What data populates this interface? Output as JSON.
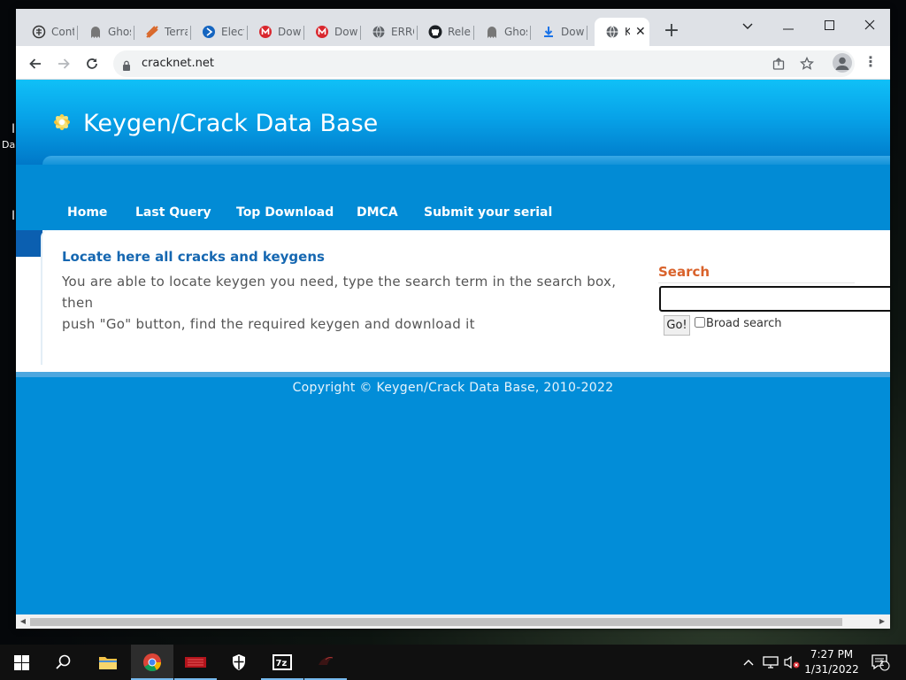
{
  "desktop": {
    "icon_labels": [
      "I",
      "Da",
      "I"
    ]
  },
  "browser": {
    "tabs": [
      {
        "label": "Cont",
        "icon": "cont-icon"
      },
      {
        "label": "Ghos",
        "icon": "ghost-icon"
      },
      {
        "label": "Terra",
        "icon": "terraria-icon"
      },
      {
        "label": "Elect",
        "icon": "electron-icon"
      },
      {
        "label": "Dow",
        "icon": "mega-icon"
      },
      {
        "label": "Dow",
        "icon": "mega-icon"
      },
      {
        "label": "ERRO",
        "icon": "globe-icon"
      },
      {
        "label": "Rele",
        "icon": "github-icon"
      },
      {
        "label": "Ghos",
        "icon": "ghost-icon"
      },
      {
        "label": "Dow",
        "icon": "download-icon"
      },
      {
        "label": "K",
        "icon": "globe-icon",
        "active": true
      }
    ],
    "new_tab": "+",
    "window_controls": {
      "dropdown": "⌄",
      "minimize": "—",
      "maximize": "☐",
      "close": "✕"
    },
    "url": "cracknet.net"
  },
  "site": {
    "title": "Keygen/Crack Data Base",
    "nav": [
      "Home",
      "Last Query",
      "Top Download",
      "DMCA",
      "Submit your serial"
    ],
    "heading": "Locate here all cracks and keygens",
    "intro_line1": "You are able to locate keygen you need, type the search term in the search box, then",
    "intro_line2": "push \"Go\" button, find the required keygen and download it",
    "search": {
      "label": "Search",
      "value": "",
      "button": "Go!",
      "broad_label": "Broad search",
      "broad_checked": false
    },
    "footer": "Copyright © Keygen/Crack Data Base, 2010-2022"
  },
  "taskbar": {
    "time": "7:27 PM",
    "date": "1/31/2022",
    "apps": [
      "start-icon",
      "search-icon",
      "file-explorer-icon",
      "chrome-icon",
      "app-red-icon",
      "defender-icon",
      "7zip-icon",
      "app-dark-icon"
    ],
    "notification_count": "1"
  },
  "colors": {
    "header_top": "#10c0f7",
    "body_bg": "#028dd8",
    "heading": "#1567b1",
    "search_label": "#d9622b"
  }
}
